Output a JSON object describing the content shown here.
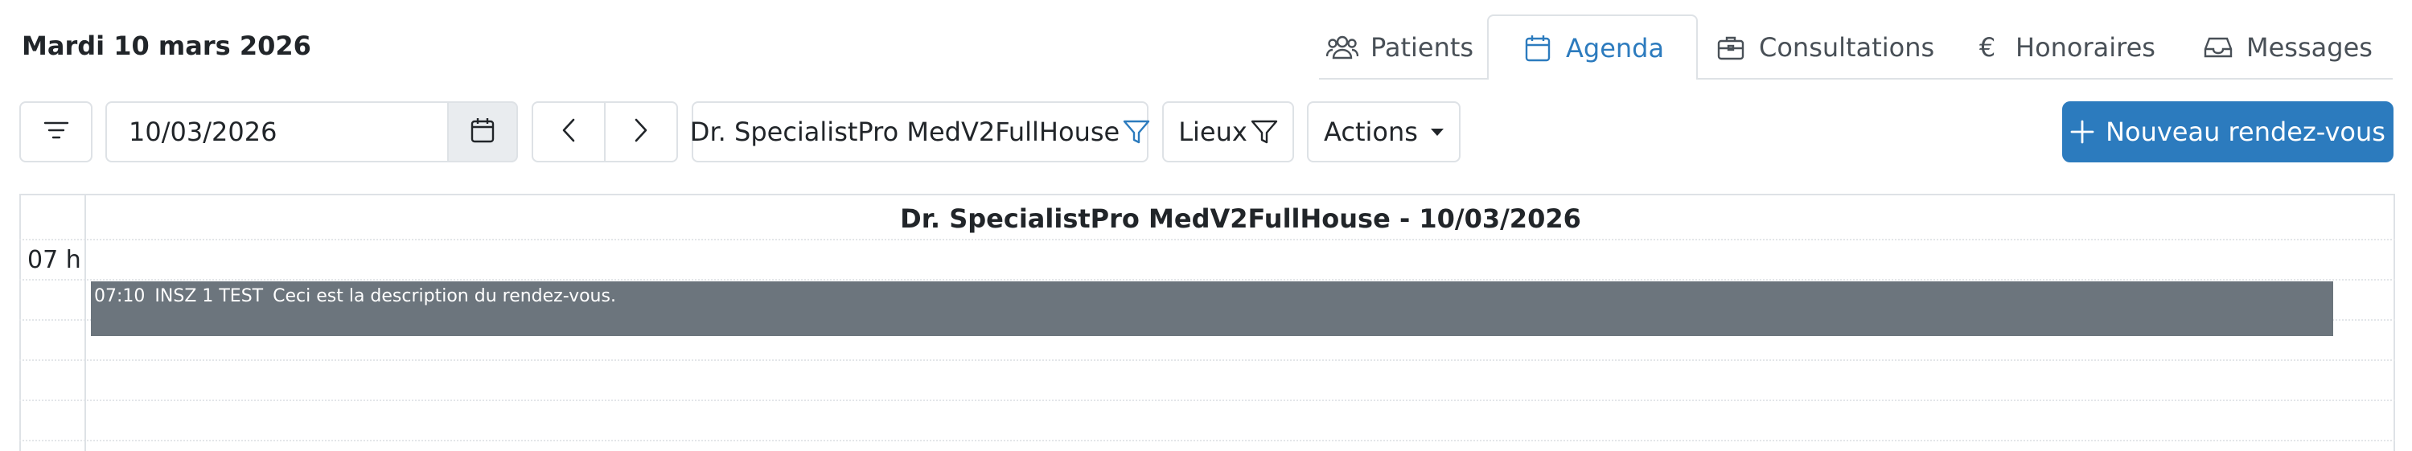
{
  "header": {
    "date_title": "Mardi 10 mars 2026",
    "tabs": [
      {
        "label": "Patients",
        "icon": "users-icon"
      },
      {
        "label": "Agenda",
        "icon": "calendar-icon",
        "active": true
      },
      {
        "label": "Consultations",
        "icon": "briefcase-icon"
      },
      {
        "label": "Honoraires",
        "icon": "euro-icon"
      },
      {
        "label": "Messages",
        "icon": "inbox-icon"
      }
    ],
    "euro_symbol": "€"
  },
  "toolbar": {
    "filter_icon": "sliders-icon",
    "date_value": "10/03/2026",
    "calendar_icon": "calendar-icon",
    "prev_icon": "chevron-left-icon",
    "next_icon": "chevron-right-icon",
    "doctor_label": "Dr. SpecialistPro MedV2FullHouse",
    "lieux_label": "Lieux",
    "actions_label": "Actions",
    "new_appointment_label": "Nouveau rendez-vous",
    "new_appointment_icon": "plus-icon"
  },
  "calendar": {
    "header": "Dr. SpecialistPro MedV2FullHouse - 10/03/2026",
    "hours": [
      "07 h"
    ],
    "events": [
      {
        "time": "07:10",
        "patient": "INSZ 1 TEST",
        "description": "Ceci est la description du rendez-vous."
      }
    ]
  },
  "colors": {
    "primary": "#2c7bbe",
    "event_bg": "#6c757d",
    "border": "#dee2e6"
  }
}
